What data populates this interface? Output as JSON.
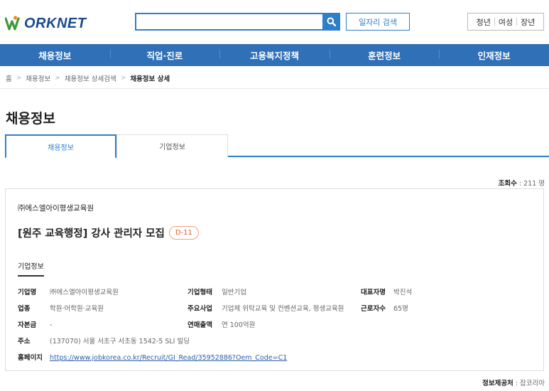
{
  "header": {
    "logo_text": "ORKNET",
    "search_placeholder": "",
    "job_search_label": "일자리 검색",
    "group_links": [
      "청년",
      "여성",
      "장년"
    ]
  },
  "gnb": [
    "채용정보",
    "직업·진로",
    "고용복지정책",
    "훈련정보",
    "인재정보"
  ],
  "breadcrumb": [
    "홈",
    "채용정보",
    "채용정보 상세검색",
    "채용정보 상세"
  ],
  "page_title": "채용정보",
  "tabs": [
    "채용정보",
    "기업정보"
  ],
  "view_count": {
    "label": "조회수",
    "value": " : 211 명"
  },
  "card": {
    "company": "㈜에스엘아이평생교육원",
    "title": "[원주 교육행정] 강사 관리자 모집",
    "dday": "D-11",
    "section_label": "기업정보",
    "fields": {
      "company_name": {
        "k": "기업명",
        "v": "㈜에스엘아이평생교육원"
      },
      "company_type": {
        "k": "기업형태",
        "v": "일반기업"
      },
      "ceo": {
        "k": "대표자명",
        "v": "박진석"
      },
      "industry": {
        "k": "업종",
        "v": "학원·어학원·교육원"
      },
      "business": {
        "k": "주요사업",
        "v": "기업체 위탁교육 및 컨벤션교육, 평생교육원"
      },
      "employees": {
        "k": "근로자수",
        "v": "65명"
      },
      "capital": {
        "k": "자본금",
        "v": "-"
      },
      "sales": {
        "k": "연매출액",
        "v": "연 100억원"
      },
      "address": {
        "k": "주소",
        "v": "(137070) 서울 서초구 서초동 1542-5 SLI 빌딩"
      },
      "homepage": {
        "k": "홈페이지",
        "v": "https://www.jobkorea.co.kr/Recruit/GI_Read/35952886?Oem_Code=C1"
      }
    }
  },
  "provider": {
    "label": "정보제공처",
    "value": " : 잡코리아"
  },
  "colors": {
    "primary": "#2f70b7",
    "accent": "#2d7fc9",
    "dday": "#e05a2b"
  }
}
